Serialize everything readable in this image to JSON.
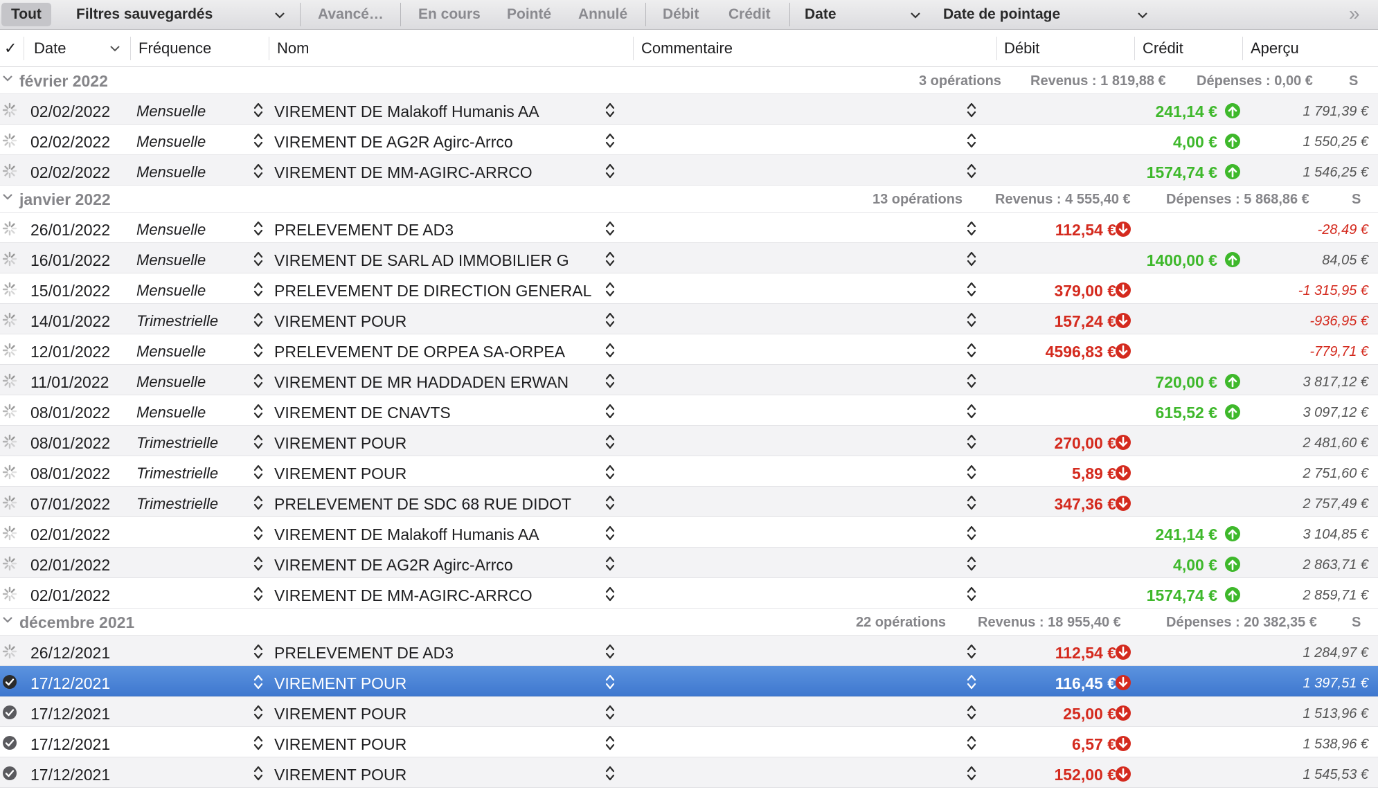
{
  "toolbar": {
    "all": "Tout",
    "saved_filters": "Filtres sauvegardés",
    "advanced": "Avancé…",
    "in_progress": "En cours",
    "checked": "Pointé",
    "cancelled": "Annulé",
    "debit": "Débit",
    "credit": "Crédit",
    "sort_date": "Date",
    "sort_check_date": "Date de pointage",
    "more": "»"
  },
  "columns": {
    "check": "✓",
    "date": "Date",
    "frequency": "Fréquence",
    "name": "Nom",
    "comment": "Commentaire",
    "debit": "Débit",
    "credit": "Crédit",
    "preview": "Aperçu"
  },
  "colors": {
    "debit": "#d42a1e",
    "credit": "#3eb82b",
    "selected": "#4a84d6"
  },
  "groups": [
    {
      "title": "février 2022",
      "ops": "3 opérations",
      "revenue": "Revenus : 1 819,88 €",
      "expenses": "Dépenses : 0,00 €",
      "tail": "S",
      "rows": [
        {
          "status": "pending",
          "date": "02/02/2022",
          "freq": "Mensuelle",
          "name": "VIREMENT DE Malakoff Humanis AA",
          "type": "credit",
          "amount": "241,14 €",
          "balance": "1 791,39 €"
        },
        {
          "status": "pending",
          "date": "02/02/2022",
          "freq": "Mensuelle",
          "name": "VIREMENT DE AG2R Agirc-Arrco",
          "type": "credit",
          "amount": "4,00 €",
          "balance": "1 550,25 €"
        },
        {
          "status": "pending",
          "date": "02/02/2022",
          "freq": "Mensuelle",
          "name": "VIREMENT DE MM-AGIRC-ARRCO",
          "type": "credit",
          "amount": "1574,74 €",
          "balance": "1 546,25 €"
        }
      ]
    },
    {
      "title": "janvier 2022",
      "ops": "13 opérations",
      "revenue": "Revenus : 4 555,40 €",
      "expenses": "Dépenses : 5 868,86 €",
      "tail": "S",
      "rows": [
        {
          "status": "pending",
          "date": "26/01/2022",
          "freq": "Mensuelle",
          "name": "PRELEVEMENT DE AD3",
          "type": "debit",
          "amount": "112,54 €",
          "balance": "-28,49 €"
        },
        {
          "status": "pending",
          "date": "16/01/2022",
          "freq": "Mensuelle",
          "name": "VIREMENT DE SARL AD IMMOBILIER G",
          "type": "credit",
          "amount": "1400,00 €",
          "balance": "84,05 €"
        },
        {
          "status": "pending",
          "date": "15/01/2022",
          "freq": "Mensuelle",
          "name": "PRELEVEMENT DE DIRECTION GENERAL",
          "type": "debit",
          "amount": "379,00 €",
          "balance": "-1 315,95 €"
        },
        {
          "status": "pending",
          "date": "14/01/2022",
          "freq": "Trimestrielle",
          "name": "VIREMENT POUR",
          "type": "debit",
          "amount": "157,24 €",
          "balance": "-936,95 €"
        },
        {
          "status": "pending",
          "date": "12/01/2022",
          "freq": "Mensuelle",
          "name": "PRELEVEMENT DE ORPEA SA-ORPEA",
          "type": "debit",
          "amount": "4596,83 €",
          "balance": "-779,71 €"
        },
        {
          "status": "pending",
          "date": "11/01/2022",
          "freq": "Mensuelle",
          "name": "VIREMENT DE MR HADDADEN ERWAN",
          "type": "credit",
          "amount": "720,00 €",
          "balance": "3 817,12 €"
        },
        {
          "status": "pending",
          "date": "08/01/2022",
          "freq": "Mensuelle",
          "name": "VIREMENT DE CNAVTS",
          "type": "credit",
          "amount": "615,52 €",
          "balance": "3 097,12 €"
        },
        {
          "status": "pending",
          "date": "08/01/2022",
          "freq": "Trimestrielle",
          "name": "VIREMENT POUR",
          "type": "debit",
          "amount": "270,00 €",
          "balance": "2 481,60 €"
        },
        {
          "status": "pending",
          "date": "08/01/2022",
          "freq": "Trimestrielle",
          "name": "VIREMENT POUR",
          "type": "debit",
          "amount": "5,89 €",
          "balance": "2 751,60 €"
        },
        {
          "status": "pending",
          "date": "07/01/2022",
          "freq": "Trimestrielle",
          "name": "PRELEVEMENT DE SDC 68 RUE DIDOT",
          "type": "debit",
          "amount": "347,36 €",
          "balance": "2 757,49 €"
        },
        {
          "status": "pending",
          "date": "02/01/2022",
          "freq": "",
          "name": "VIREMENT DE Malakoff Humanis AA",
          "type": "credit",
          "amount": "241,14 €",
          "balance": "3 104,85 €"
        },
        {
          "status": "pending",
          "date": "02/01/2022",
          "freq": "",
          "name": "VIREMENT DE AG2R Agirc-Arrco",
          "type": "credit",
          "amount": "4,00 €",
          "balance": "2 863,71 €"
        },
        {
          "status": "pending",
          "date": "02/01/2022",
          "freq": "",
          "name": "VIREMENT DE MM-AGIRC-ARRCO",
          "type": "credit",
          "amount": "1574,74 €",
          "balance": "2 859,71 €"
        }
      ]
    },
    {
      "title": "décembre 2021",
      "ops": "22 opérations",
      "revenue": "Revenus : 18 955,40 €",
      "expenses": "Dépenses : 20 382,35 €",
      "tail": "S",
      "rows": [
        {
          "status": "pending",
          "date": "26/12/2021",
          "freq": "",
          "name": "PRELEVEMENT DE AD3",
          "type": "debit",
          "amount": "112,54 €",
          "balance": "1 284,97 €"
        },
        {
          "status": "checked",
          "selected": true,
          "date": "17/12/2021",
          "freq": "",
          "name": "VIREMENT POUR",
          "type": "debit",
          "amount": "116,45 €",
          "balance": "1 397,51 €"
        },
        {
          "status": "checked",
          "date": "17/12/2021",
          "freq": "",
          "name": "VIREMENT POUR",
          "type": "debit",
          "amount": "25,00 €",
          "balance": "1 513,96 €"
        },
        {
          "status": "checked",
          "date": "17/12/2021",
          "freq": "",
          "name": "VIREMENT POUR",
          "type": "debit",
          "amount": "6,57 €",
          "balance": "1 538,96 €"
        },
        {
          "status": "checked",
          "date": "17/12/2021",
          "freq": "",
          "name": "VIREMENT POUR",
          "type": "debit",
          "amount": "152,00 €",
          "balance": "1 545,53 €"
        }
      ]
    }
  ]
}
